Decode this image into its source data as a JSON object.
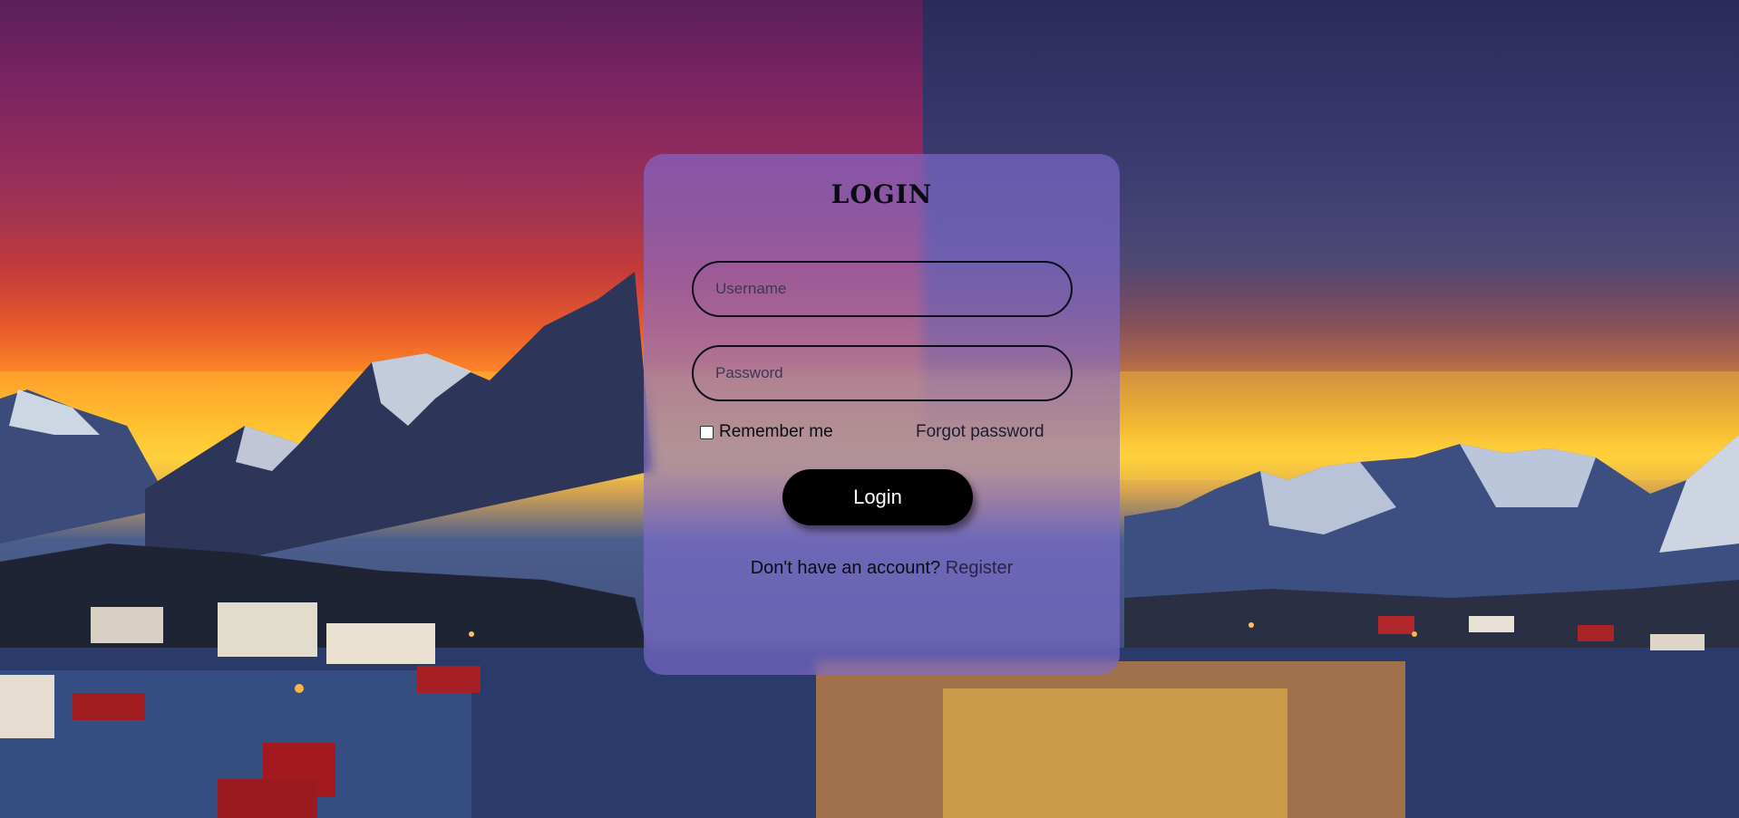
{
  "login_form": {
    "title": "LOGIN",
    "username_placeholder": "Username",
    "password_placeholder": "Password",
    "remember_label": "Remember me",
    "remember_checked": false,
    "forgot_label": "Forgot password",
    "submit_label": "Login",
    "register_prompt": "Don't have an account?",
    "register_link": "Register"
  },
  "theme": {
    "card_color": "#826ED2",
    "button_color": "#000000",
    "button_text_color": "#FFFFFF"
  }
}
